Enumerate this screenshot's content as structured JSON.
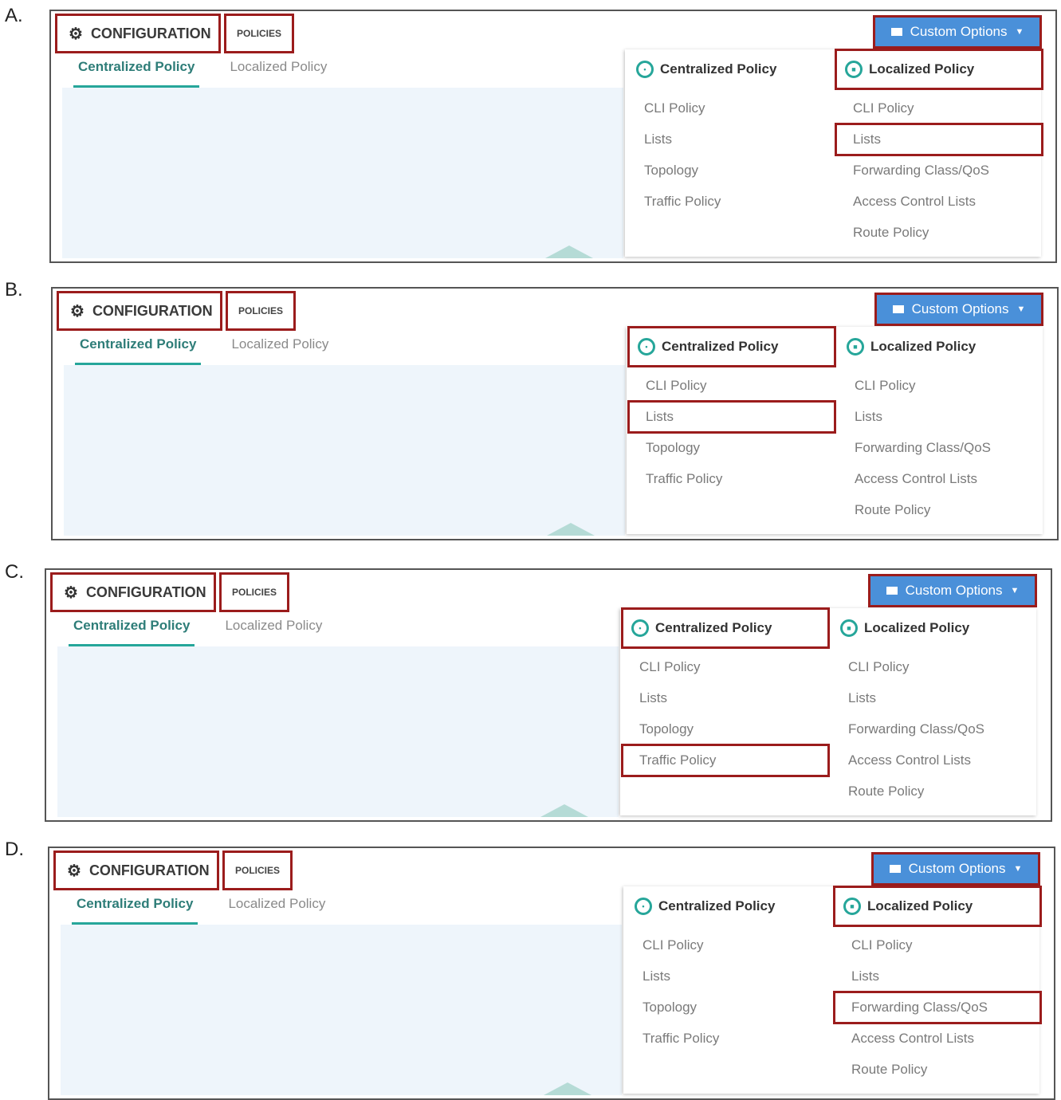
{
  "options": [
    {
      "letter": "A.",
      "highlight": {
        "config": true,
        "policies": true,
        "custom": true,
        "central_head": false,
        "local_head": true,
        "central_item": null,
        "local_item": 1
      }
    },
    {
      "letter": "B.",
      "highlight": {
        "config": true,
        "policies": true,
        "custom": true,
        "central_head": true,
        "local_head": false,
        "central_item": 1,
        "local_item": null
      }
    },
    {
      "letter": "C.",
      "highlight": {
        "config": true,
        "policies": true,
        "custom": true,
        "central_head": true,
        "local_head": false,
        "central_item": 3,
        "local_item": null
      }
    },
    {
      "letter": "D.",
      "highlight": {
        "config": true,
        "policies": true,
        "custom": true,
        "central_head": false,
        "local_head": true,
        "central_item": null,
        "local_item": 2
      }
    }
  ],
  "ui": {
    "config_label": "CONFIGURATION",
    "policies_label": "POLICIES",
    "tabs": [
      "Centralized Policy",
      "Localized Policy"
    ],
    "custom_options_label": "Custom Options",
    "centralized": {
      "title": "Centralized Policy",
      "items": [
        "CLI Policy",
        "Lists",
        "Topology",
        "Traffic Policy"
      ]
    },
    "localized": {
      "title": "Localized Policy",
      "items": [
        "CLI Policy",
        "Lists",
        "Forwarding Class/QoS",
        "Access Control Lists",
        "Route Policy"
      ]
    }
  },
  "colors": {
    "highlight": "#9b1c1c",
    "accent": "#26a69a",
    "button": "#4a90d9"
  },
  "icons": {
    "config": "gear-icon",
    "caret": "caret-down-icon",
    "centralized": "globe-icon",
    "localized": "folder-icon"
  }
}
